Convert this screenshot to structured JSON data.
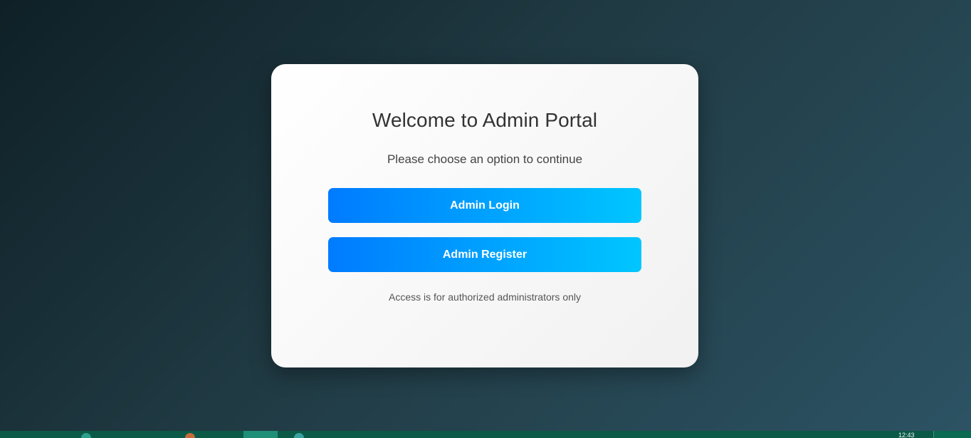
{
  "card": {
    "title": "Welcome to Admin Portal",
    "subtitle": "Please choose an option to continue",
    "login_label": "Admin Login",
    "register_label": "Admin Register",
    "note": "Access is for authorized administrators only"
  },
  "taskbar": {
    "clock": "12:43"
  },
  "colors": {
    "button_gradient_start": "#007bff",
    "button_gradient_end": "#00c6ff",
    "background_start": "#0f2027",
    "background_end": "#2c5364",
    "taskbar": "#0b5a48"
  }
}
